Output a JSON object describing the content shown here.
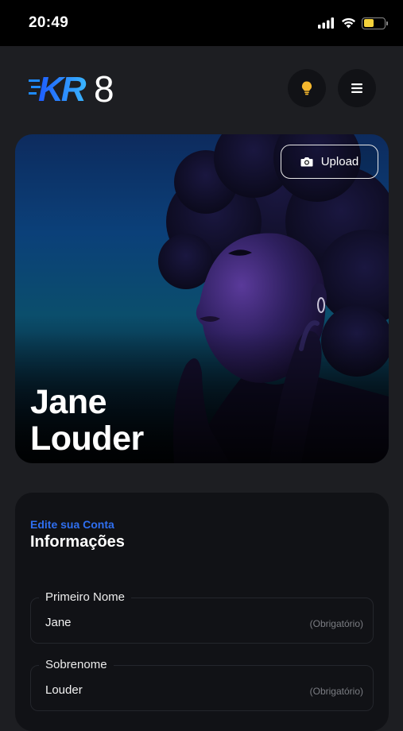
{
  "status_bar": {
    "time": "20:49",
    "battery_level": 0.5
  },
  "header": {
    "logo_text": "KR8",
    "tip_icon": "lightbulb-icon",
    "menu_icon": "hamburger-menu-icon"
  },
  "profile": {
    "upload_label": "Upload",
    "upload_icon": "camera-icon",
    "first_name": "Jane",
    "last_name": "Louder"
  },
  "account_card": {
    "eyebrow": "Edite sua Conta",
    "title": "Informações",
    "fields": [
      {
        "label": "Primeiro Nome",
        "value": "Jane",
        "hint": "(Obrigatório)"
      },
      {
        "label": "Sobrenome",
        "value": "Louder",
        "hint": "(Obrigatório)"
      }
    ]
  },
  "colors": {
    "background": "#1d1e22",
    "card": "#111216",
    "accent": "#2f6ff0",
    "bulb": "#f5b82e"
  }
}
